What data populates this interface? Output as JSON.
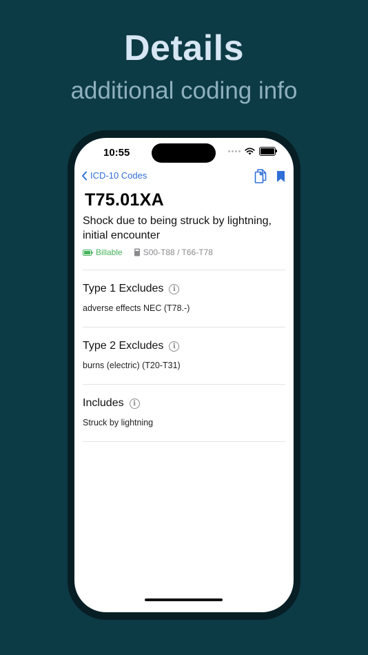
{
  "promo": {
    "title": "Details",
    "subtitle": "additional coding info"
  },
  "status_bar": {
    "time": "10:55"
  },
  "nav": {
    "back_label": "ICD-10 Codes"
  },
  "code": {
    "id": "T75.01XA",
    "description": "Shock due to being struck by lightning, initial encounter",
    "billable_label": "Billable",
    "range": "S00-T88 / T66-T78"
  },
  "sections": [
    {
      "title": "Type 1 Excludes",
      "body": "adverse effects NEC (T78.-)"
    },
    {
      "title": "Type 2 Excludes",
      "body": "burns (electric) (T20-T31)"
    },
    {
      "title": "Includes",
      "body": "Struck by lightning"
    }
  ],
  "colors": {
    "background": "#0c3a45",
    "accent": "#2f6fd6",
    "billable": "#45b35a"
  }
}
